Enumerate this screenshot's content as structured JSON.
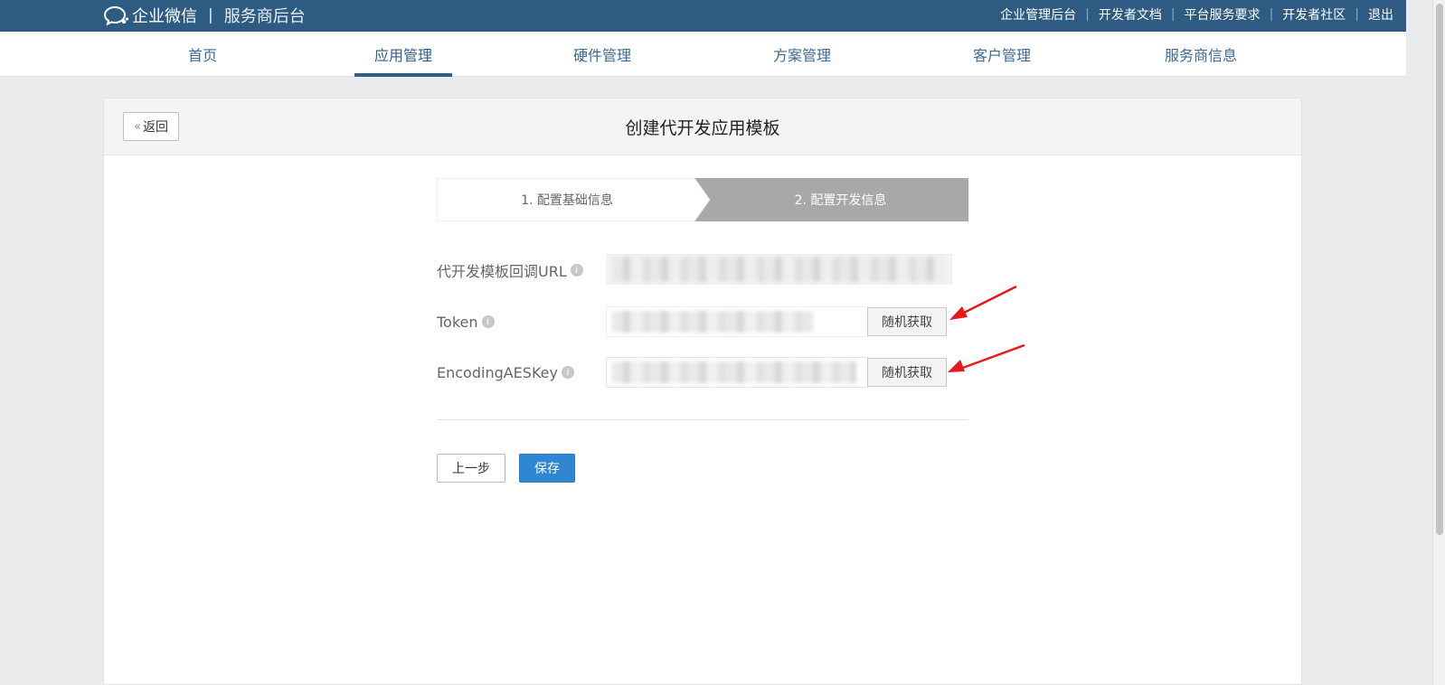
{
  "topbar": {
    "brand": "企业微信",
    "separator": "|",
    "subtitle": "服务商后台",
    "links": [
      "企业管理后台",
      "开发者文档",
      "平台服务要求",
      "开发者社区",
      "退出"
    ],
    "link_separator": "|"
  },
  "nav": {
    "items": [
      "首页",
      "应用管理",
      "硬件管理",
      "方案管理",
      "客户管理",
      "服务商信息"
    ],
    "active": "应用管理"
  },
  "card": {
    "back_chevron": "«",
    "back_label": "返回",
    "title": "创建代开发应用模板"
  },
  "steps": {
    "step1": "1. 配置基础信息",
    "step2": "2. 配置开发信息",
    "active_step": 2
  },
  "form": {
    "callback_url_label": "代开发模板回调URL",
    "token_label": "Token",
    "aeskey_label": "EncodingAESKey",
    "info_glyph": "i",
    "random_button_label": "随机获取"
  },
  "actions": {
    "prev_label": "上一步",
    "save_label": "保存"
  },
  "colors": {
    "topbar": "#2e5b82",
    "nav_active": "#2c5f8c",
    "primary_button": "#2f86d1",
    "step_active": "#a8a8a8",
    "annotation_arrow": "#e8191b"
  }
}
